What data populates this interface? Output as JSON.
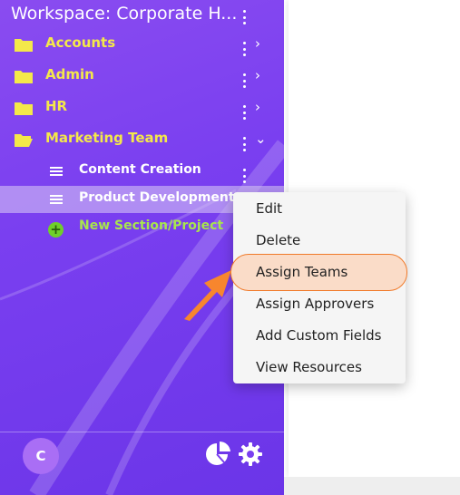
{
  "workspace": {
    "title": "Workspace: Corporate H..."
  },
  "folders": [
    {
      "label": "Accounts",
      "icon": "folder-icon",
      "expanded": false
    },
    {
      "label": "Admin",
      "icon": "folder-icon",
      "expanded": false
    },
    {
      "label": "HR",
      "icon": "folder-icon",
      "expanded": false
    },
    {
      "label": "Marketing Team",
      "icon": "folder-open-icon",
      "expanded": true
    }
  ],
  "sections": [
    {
      "label": "Content Creation",
      "icon": "list-icon"
    },
    {
      "label": "Product Development",
      "icon": "list-icon",
      "selected": true
    }
  ],
  "new_section": {
    "label": "New Section/Project",
    "icon": "plus-circle-icon"
  },
  "context_menu": {
    "items": [
      "Edit",
      "Delete",
      "Assign Teams",
      "Assign Approvers",
      "Add Custom Fields",
      "View Resources"
    ],
    "highlighted": "Assign Teams"
  },
  "footer": {
    "avatar_letter": "C",
    "icons": [
      "pie-chart-icon",
      "gear-icon"
    ]
  },
  "colors": {
    "sidebar": "#7a3ff0",
    "folder_label": "#f4e84a",
    "new_section": "#a8e64d",
    "highlight_fill": "#fadcc8",
    "highlight_border": "#f07a2a",
    "arrow": "#f7862e"
  }
}
